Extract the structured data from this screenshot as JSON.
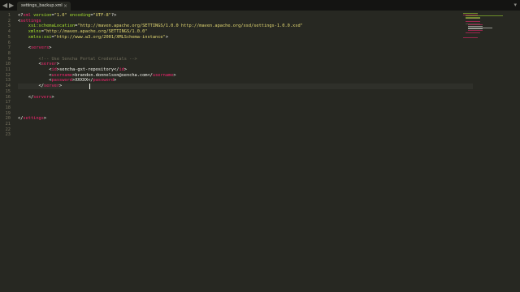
{
  "tabbar": {
    "back_arrow": "◀",
    "forward_arrow": "▶",
    "tab_label": "settings_backup.xml",
    "tab_close": "×",
    "dropdown": "▾"
  },
  "colors": {
    "tag": "#f92672",
    "attribute": "#a6e22e",
    "string": "#e6db74",
    "comment": "#75715e",
    "text": "#f8f8f2",
    "background": "#272822"
  },
  "editor": {
    "current_line": 14,
    "line_numbers": [
      "1",
      "2",
      "3",
      "4",
      "5",
      "6",
      "7",
      "8",
      "9",
      "10",
      "11",
      "12",
      "13",
      "14",
      "15",
      "16",
      "17",
      "18",
      "19",
      "20",
      "21",
      "22",
      "23"
    ],
    "lines": [
      [
        [
          "t-punct",
          "<?"
        ],
        [
          "t-tag",
          "xml"
        ],
        [
          "t-attr",
          " version"
        ],
        [
          "t-punct",
          "="
        ],
        [
          "t-str",
          "\"1.0\""
        ],
        [
          "t-attr",
          " encoding"
        ],
        [
          "t-punct",
          "="
        ],
        [
          "t-str",
          "\"UTF-8\""
        ],
        [
          "t-punct",
          "?>"
        ]
      ],
      [
        [
          "t-punct",
          "<"
        ],
        [
          "t-tag",
          "settings"
        ]
      ],
      [
        [
          "t-attr",
          "    xsi:schemaLocation"
        ],
        [
          "t-punct",
          "="
        ],
        [
          "t-str",
          "\"http://maven.apache.org/SETTINGS/1.0.0 http://maven.apache.org/xsd/settings-1.0.0.xsd\""
        ]
      ],
      [
        [
          "t-attr",
          "    xmlns"
        ],
        [
          "t-punct",
          "="
        ],
        [
          "t-str",
          "\"http://maven.apache.org/SETTINGS/1.0.0\""
        ]
      ],
      [
        [
          "t-attr",
          "    xmlns:xsi"
        ],
        [
          "t-punct",
          "="
        ],
        [
          "t-str",
          "\"http://www.w3.org/2001/XMLSchema-instance\""
        ],
        [
          "t-punct",
          ">"
        ]
      ],
      [],
      [
        [
          "t-punct",
          "    <"
        ],
        [
          "t-tag",
          "servers"
        ],
        [
          "t-punct",
          ">"
        ]
      ],
      [],
      [
        [
          "t-comment",
          "        <!-- Use Sencha Portal Credentials -->"
        ]
      ],
      [
        [
          "t-punct",
          "        <"
        ],
        [
          "t-tag",
          "server"
        ],
        [
          "t-punct",
          ">"
        ]
      ],
      [
        [
          "t-punct",
          "            <"
        ],
        [
          "t-tag",
          "id"
        ],
        [
          "t-punct",
          ">"
        ],
        [
          "t-text",
          "sencha-gxt-repository"
        ],
        [
          "t-punct",
          "</"
        ],
        [
          "t-tag",
          "id"
        ],
        [
          "t-punct",
          ">"
        ]
      ],
      [
        [
          "t-punct",
          "            <"
        ],
        [
          "t-tag",
          "username"
        ],
        [
          "t-punct",
          ">"
        ],
        [
          "t-text",
          "brandon.donnelson@sencha.com"
        ],
        [
          "t-punct",
          "</"
        ],
        [
          "t-tag",
          "username"
        ],
        [
          "t-punct",
          ">"
        ]
      ],
      [
        [
          "t-punct",
          "            <"
        ],
        [
          "t-tag",
          "password"
        ],
        [
          "t-punct",
          ">"
        ],
        [
          "t-text",
          "XXXXX"
        ],
        [
          "t-punct",
          "</"
        ],
        [
          "t-tag",
          "password"
        ],
        [
          "t-punct",
          ">"
        ]
      ],
      [
        [
          "t-punct",
          "        </"
        ],
        [
          "t-tag",
          "server"
        ],
        [
          "t-punct",
          ">"
        ]
      ],
      [],
      [
        [
          "t-punct",
          "    </"
        ],
        [
          "t-tag",
          "servers"
        ],
        [
          "t-punct",
          ">"
        ]
      ],
      [],
      [],
      [],
      [
        [
          "t-punct",
          "</"
        ],
        [
          "t-tag",
          "settings"
        ],
        [
          "t-punct",
          ">"
        ]
      ],
      [],
      [],
      []
    ]
  },
  "minimap": {
    "line_colors": [
      "#a6e22e",
      "#f92672",
      "#a6e22e",
      "#a6e22e",
      "#e6db74",
      "",
      "#f92672",
      "",
      "#75715e",
      "#f92672",
      "#f8f8f2",
      "#f8f8f2",
      "#f8f8f2",
      "#f92672",
      "",
      "#f92672",
      "",
      "",
      "",
      "#f92672"
    ]
  }
}
